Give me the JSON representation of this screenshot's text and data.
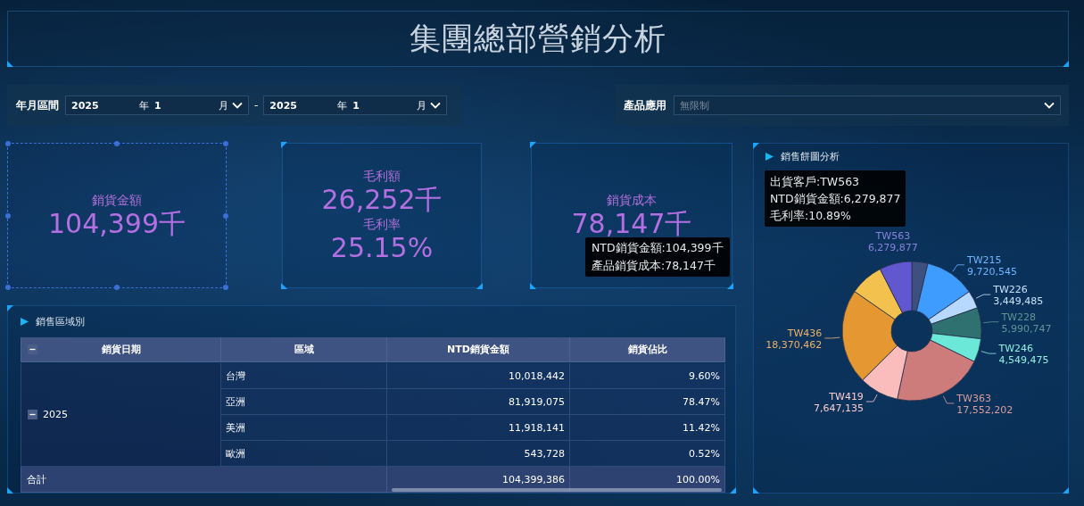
{
  "title": "集團總部營銷分析",
  "filters": {
    "date_range": {
      "label": "年月區間",
      "from": {
        "year": "2025",
        "year_unit": "年",
        "month": "1",
        "month_unit": "月"
      },
      "separator": "-",
      "to": {
        "year": "2025",
        "year_unit": "年",
        "month": "1",
        "month_unit": "月"
      }
    },
    "product": {
      "label": "產品應用",
      "placeholder": "無限制"
    }
  },
  "kpis": [
    {
      "label": "銷貨金額",
      "value": "104,399千",
      "selected": true
    },
    {
      "label": "毛利額",
      "value": "26,252千",
      "sub_label": "毛利率",
      "sub_value": "25.15%",
      "selected": false
    },
    {
      "label": "銷貨成本",
      "value": "78,147千",
      "selected": false,
      "tooltip": [
        "NTD銷貨金額:104,399千",
        "產品銷貨成本:78,147千"
      ]
    }
  ],
  "region_table": {
    "title": "銷售區域別",
    "columns": [
      "銷貨日期",
      "區域",
      "NTD銷貨金額",
      "銷貨佔比"
    ],
    "groups": [
      {
        "label": "2025",
        "expanded": true,
        "rows": [
          {
            "region": "台灣",
            "amount": "10,018,442",
            "share": "9.60%"
          },
          {
            "region": "亞洲",
            "amount": "81,919,075",
            "share": "78.47%"
          },
          {
            "region": "美洲",
            "amount": "11,918,141",
            "share": "11.42%"
          },
          {
            "region": "歐洲",
            "amount": "543,728",
            "share": "0.52%"
          }
        ]
      }
    ],
    "total": {
      "label": "合計",
      "amount": "104,399,386",
      "share": "100.00%"
    }
  },
  "pie": {
    "title": "銷售餅圖分析",
    "chart_data": {
      "type": "donut",
      "categories": [
        null,
        "TW215",
        "TW226",
        "TW228",
        "TW246",
        "TW363",
        "TW419",
        "TW436",
        null,
        "TW563"
      ],
      "value_labels": [
        null,
        "9,720,545",
        "3,449,485",
        "5,990,747",
        "4,549,475",
        "17,552,202",
        "7,647,135",
        "18,370,462",
        null,
        "6,279,877"
      ],
      "colors": [
        "#3d5080",
        "#3f9cff",
        "#b7d9ff",
        "#2f7070",
        "#6ce8d8",
        "#cd7b7b",
        "#fbbcbc",
        "#e59832",
        "#f2c14e",
        "#6158d0"
      ],
      "series": [
        {
          "values": [
            3.73,
            11.69,
            4.15,
            7.2,
            5.47,
            21.11,
            9.2,
            22.09,
            7.82,
            7.54
          ]
        }
      ]
    },
    "tooltip": [
      "出貨客戶:TW563",
      "NTD銷貨金額:6,279,877",
      "毛利率:10.89%"
    ]
  }
}
